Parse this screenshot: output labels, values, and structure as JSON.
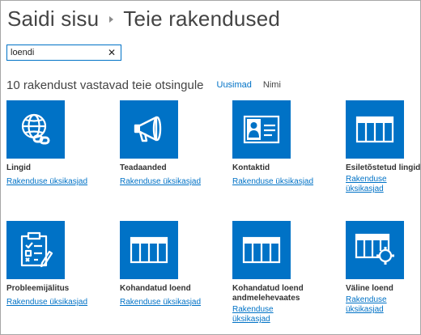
{
  "breadcrumb": {
    "parent": "Saidi sisu",
    "current": "Teie rakendused"
  },
  "search": {
    "value": "loendi",
    "clear_glyph": "✕"
  },
  "results": {
    "heading": "10 rakendust vastavad teie otsingule",
    "sort_options": [
      "Uusimad",
      "Nimi"
    ],
    "active_sort": "Uusimad"
  },
  "accent_color": "#0072c6",
  "apps": [
    {
      "title": "Lingid",
      "link": "Rakenduse üksikasjad",
      "icon": "globe-link-icon"
    },
    {
      "title": "Teadaanded",
      "link": "Rakenduse üksikasjad",
      "icon": "megaphone-icon"
    },
    {
      "title": "Kontaktid",
      "link": "Rakenduse üksikasjad",
      "icon": "contact-card-icon"
    },
    {
      "title": "Esiletõstetud lingid",
      "link": "Rakenduse üksikasjad",
      "icon": "list-grid-icon"
    },
    {
      "title": "Probleemijälitus",
      "link": "Rakenduse üksikasjad",
      "icon": "clipboard-checklist-icon"
    },
    {
      "title": "Kohandatud loend",
      "link": "Rakenduse üksikasjad",
      "icon": "list-grid-icon"
    },
    {
      "title": "Kohandatud loend andmelehevaates",
      "link": "Rakenduse üksikasjad",
      "icon": "list-grid-icon"
    },
    {
      "title": "Väline loend",
      "link": "Rakenduse üksikasjad",
      "icon": "external-list-icon"
    }
  ]
}
